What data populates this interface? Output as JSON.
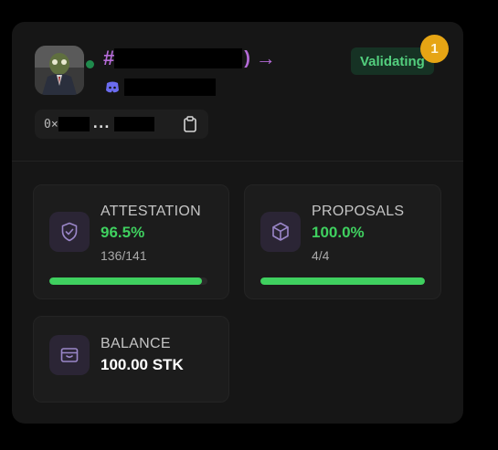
{
  "validator": {
    "hash_prefix": "#",
    "address_prefix": "0×",
    "address_ellipsis": "...",
    "status": "Validating",
    "notification_count": "1"
  },
  "stats": {
    "attestation": {
      "label": "ATTESTATION",
      "percent": "96.5%",
      "count": "136/141",
      "fill": 0.965
    },
    "proposals": {
      "label": "PROPOSALS",
      "percent": "100.0%",
      "count": "4/4",
      "fill": 1.0
    },
    "balance": {
      "label": "BALANCE",
      "amount": "100.00 STK"
    }
  },
  "icons": {
    "avatar": "avatar-image",
    "discord": "discord-icon",
    "copy": "copy-icon",
    "attestation": "shield-check-icon",
    "proposals": "cube-icon",
    "balance": "wallet-icon",
    "link": "arrow-right-icon"
  },
  "colors": {
    "accent_purple": "#b56bd8",
    "status_green": "#53cf7e",
    "progress_green": "#3fd05f",
    "notification_gold": "#e6a514"
  }
}
